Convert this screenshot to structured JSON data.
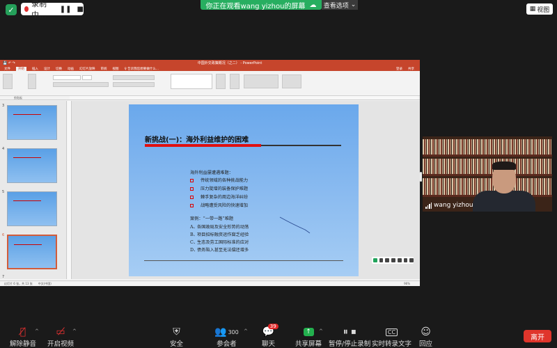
{
  "top": {
    "recording_label": "录制中...",
    "share_banner": "你正在观看wang yizhou的屏幕",
    "view_options": "查看选项",
    "view_button": "视图"
  },
  "ppt": {
    "window_title": "中国外交政策概况（之二） - PowerPoint",
    "tabs": [
      "文件",
      "开始",
      "插入",
      "设计",
      "切换",
      "动画",
      "幻灯片放映",
      "审阅",
      "视图"
    ],
    "active_tab": "开始",
    "tell_me": "♀ 告诉我您想要做什么...",
    "login": "登录",
    "share": "共享",
    "ribbon_sections": [
      "剪贴板",
      "幻灯片",
      "字体",
      "段落",
      "绘图",
      "编辑"
    ],
    "ribbon_labels": [
      "粘贴",
      "新建幻灯片",
      "版式",
      "重置",
      "节",
      "文字方向",
      "对齐文本",
      "转换为 SmartArt",
      "排列",
      "快速样式",
      "形状填充",
      "形状轮廓",
      "形状效果",
      "查找",
      "替换",
      "选择"
    ],
    "thumb_numbers": [
      "3",
      "4",
      "5",
      "6",
      "7"
    ],
    "slide": {
      "title": "新挑战(一)：海外利益维护的困难",
      "intro": "海外利益屡遭遇难题：",
      "bullets": [
        "传统领域的各种挑战能力",
        "压力陡增的装备保护难题",
        "棘手复杂的周边海洋纠纷",
        "战略遭受风险的快速增加"
      ],
      "case_title": "案例：“一带一路”难题",
      "case_items": [
        {
          "letter": "A、",
          "text": "各国政局及安全形势的动荡"
        },
        {
          "letter": "B、",
          "text": "项目招标融资运作腐乏经验"
        },
        {
          "letter": "C、",
          "text": "生态及劳工国际标准的应对"
        },
        {
          "letter": "D、",
          "text": "债务陷入甚至无法偿还增多"
        }
      ]
    },
    "status_left": "幻灯片 6 张，共 13 张",
    "status_lang": "中文(中国)",
    "zoom": "96%"
  },
  "video": {
    "participant_name": "wang yizhou"
  },
  "bottom": {
    "mute": "解除静音",
    "video": "开启视频",
    "security": "安全",
    "participants": "参会者",
    "participants_count": "300",
    "chat": "聊天",
    "chat_badge": "39",
    "share_screen": "共享屏幕",
    "record": "暂停/停止录制",
    "captions": "实时转录文字",
    "reactions": "回应",
    "leave": "离开"
  },
  "colors": {
    "ppt_accent": "#c6452c",
    "zoom_green": "#27ae60",
    "leave_red": "#e0352b",
    "slide_bg": "#8cbcf0"
  }
}
